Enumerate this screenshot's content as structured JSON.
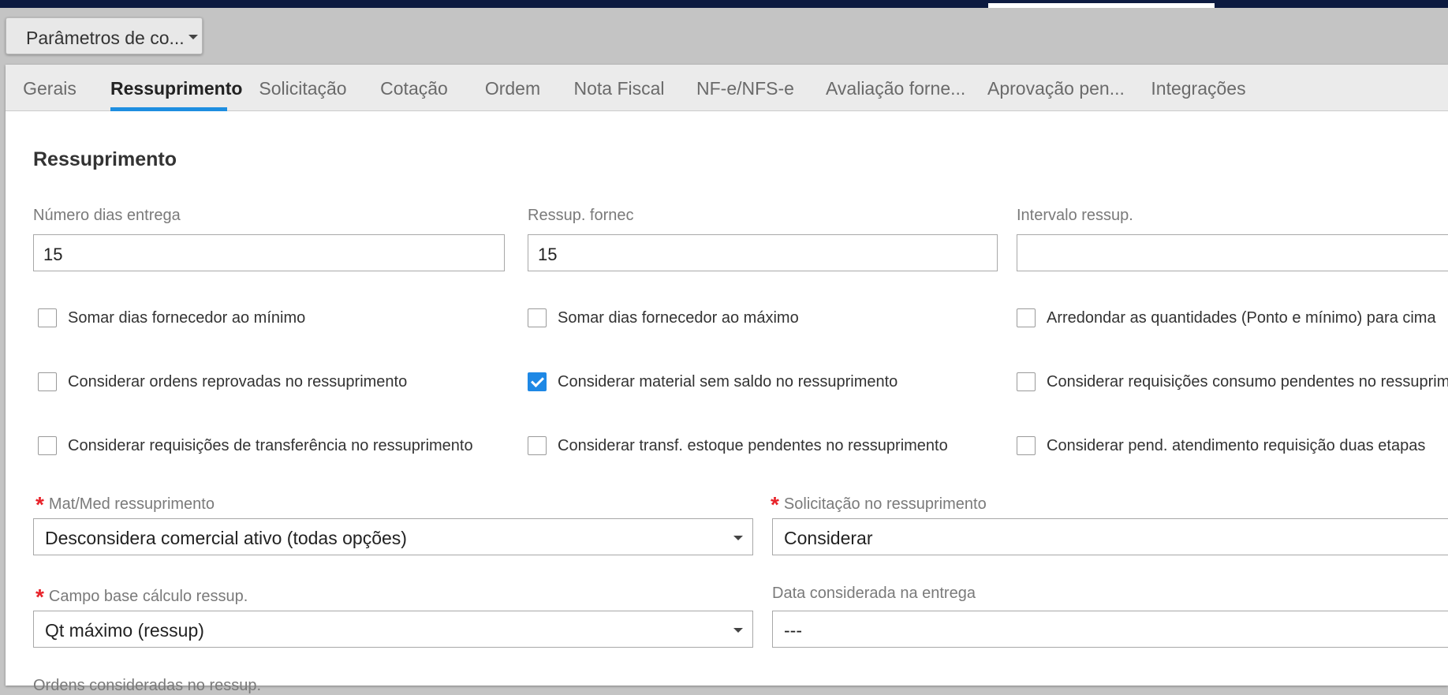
{
  "page_dropdown": {
    "label": "Parâmetros de co..."
  },
  "tabs": [
    {
      "label": "Gerais"
    },
    {
      "label": "Ressuprimento"
    },
    {
      "label": "Solicitação"
    },
    {
      "label": "Cotação"
    },
    {
      "label": "Ordem"
    },
    {
      "label": "Nota Fiscal"
    },
    {
      "label": "NF-e/NFS-e"
    },
    {
      "label": "Avaliação forne..."
    },
    {
      "label": "Aprovação pen..."
    },
    {
      "label": "Integrações"
    }
  ],
  "active_tab": "Ressuprimento",
  "section_title": "Ressuprimento",
  "fields": {
    "numero_dias_entrega": {
      "label": "Número dias entrega",
      "value": "15"
    },
    "ressup_fornec": {
      "label": "Ressup. fornec",
      "value": "15"
    },
    "intervalo_ressup": {
      "label": "Intervalo ressup.",
      "value": ""
    }
  },
  "checkboxes": [
    {
      "label": "Somar dias fornecedor ao mínimo",
      "checked": false
    },
    {
      "label": "Somar dias fornecedor ao máximo",
      "checked": false
    },
    {
      "label": "Arredondar as quantidades (Ponto e mínimo) para cima",
      "checked": false
    },
    {
      "label": "Considerar ordens reprovadas no ressuprimento",
      "checked": false
    },
    {
      "label": "Considerar material sem saldo no ressuprimento",
      "checked": true
    },
    {
      "label": "Considerar requisições consumo pendentes no ressupriment",
      "checked": false
    },
    {
      "label": "Considerar requisições de transferência no ressuprimento",
      "checked": false
    },
    {
      "label": "Considerar transf. estoque pendentes no ressuprimento",
      "checked": false
    },
    {
      "label": "Considerar pend. atendimento requisição duas etapas",
      "checked": false
    }
  ],
  "selects": {
    "mat_med": {
      "label": "Mat/Med ressuprimento",
      "required": true,
      "value": "Desconsidera comercial ativo (todas opções)"
    },
    "solicitacao": {
      "label": "Solicitação no ressuprimento",
      "required": true,
      "value": "Considerar"
    },
    "campo_base": {
      "label": "Campo base cálculo ressup.",
      "required": true,
      "value": "Qt máximo (ressup)"
    },
    "data_entrega": {
      "label": "Data considerada na entrega",
      "required": false,
      "value": "---"
    }
  },
  "next_label": "Ordens consideradas no ressup.",
  "colors": {
    "accent": "#1e8ee0",
    "required": "#e8232a",
    "topbar": "#0c1a40"
  }
}
